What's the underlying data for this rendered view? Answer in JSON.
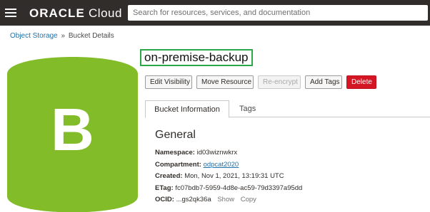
{
  "header": {
    "logo_brand": "ORACLE",
    "logo_product": "Cloud",
    "search_placeholder": "Search for resources, services, and documentation"
  },
  "breadcrumb": {
    "parent": "Object Storage",
    "separator": "»",
    "current": "Bucket Details"
  },
  "bucket_icon": {
    "letter": "B",
    "color": "#82bc28"
  },
  "title": "on-premise-backup",
  "actions": {
    "edit_visibility": "Edit Visibility",
    "move_resource": "Move Resource",
    "re_encrypt": "Re-encrypt",
    "add_tags": "Add Tags",
    "delete": "Delete"
  },
  "tabs": {
    "bucket_information": "Bucket Information",
    "tags": "Tags"
  },
  "general": {
    "heading": "General",
    "namespace_label": "Namespace:",
    "namespace_value": "id03wiznwkrx",
    "compartment_label": "Compartment:",
    "compartment_value": "odpcat2020",
    "created_label": "Created:",
    "created_value": "Mon, Nov 1, 2021, 13:19:31 UTC",
    "etag_label": "ETag:",
    "etag_value": "fc07bdb7-5959-4d8e-ac59-79d3397a95dd",
    "ocid_label": "OCID:",
    "ocid_value": "...gs2qk36a",
    "ocid_show": "Show",
    "ocid_copy": "Copy"
  },
  "colors": {
    "topbar": "#312d2a",
    "link": "#1f6fa8",
    "delete": "#d31524",
    "title_highlight": "#2aa84a"
  }
}
